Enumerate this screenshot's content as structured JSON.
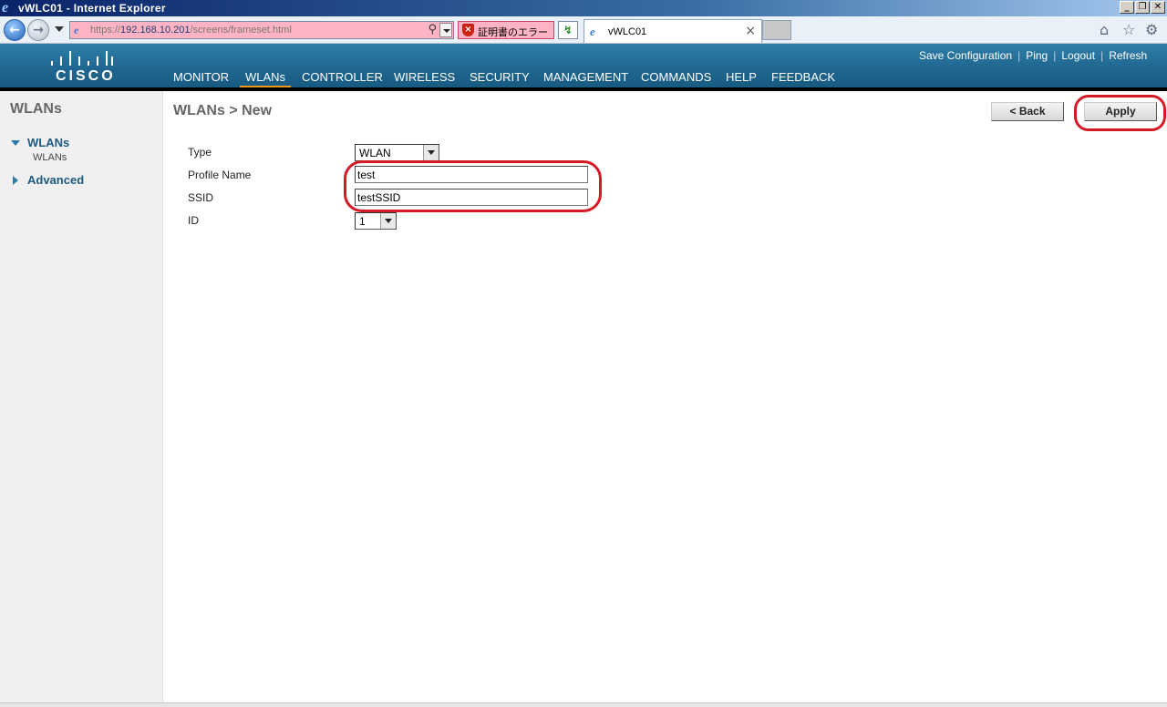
{
  "window": {
    "title": "vWLC01 - Internet Explorer"
  },
  "browser": {
    "url_prefix": "https://",
    "url_host": "192.168.10.201",
    "url_path": "/screens/frameset.html",
    "cert_error": "証明書のエラー",
    "tab_title": "vWLC01"
  },
  "header": {
    "logo_text": "CISCO",
    "top_links": [
      "Save Configuration",
      "Ping",
      "Logout",
      "Refresh"
    ],
    "nav": [
      "MONITOR",
      "WLANs",
      "CONTROLLER",
      "WIRELESS",
      "SECURITY",
      "MANAGEMENT",
      "COMMANDS",
      "HELP",
      "FEEDBACK"
    ],
    "active_nav": "WLANs",
    "accent_color": "#f29a1f"
  },
  "sidebar": {
    "title": "WLANs",
    "section": "WLANs",
    "sub_item": "WLANs",
    "advanced": "Advanced"
  },
  "main": {
    "title": "WLANs > New",
    "back_label": "< Back",
    "apply_label": "Apply",
    "fields": {
      "type_label": "Type",
      "type_value": "WLAN",
      "profile_label": "Profile Name",
      "profile_value": "test",
      "ssid_label": "SSID",
      "ssid_value": "testSSID",
      "id_label": "ID",
      "id_value": "1"
    },
    "highlight_color": "#d51a25"
  }
}
